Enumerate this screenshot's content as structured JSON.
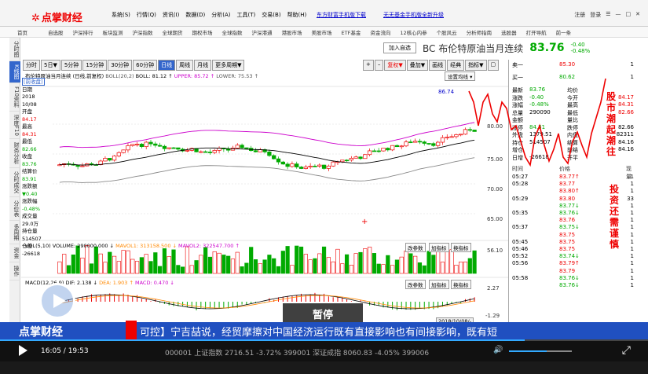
{
  "app": {
    "logo": "点掌财经"
  },
  "menu": [
    "系统(S)",
    "行情(Q)",
    "资讯(I)",
    "数据(D)",
    "分析(A)",
    "工具(T)",
    "交易(B)",
    "帮助(H)"
  ],
  "ads": {
    "ad1": "东方财富手机版下载",
    "ad2": "无无基金手机版全新升级"
  },
  "win_controls": [
    "注册",
    "登录",
    "☰",
    "—",
    "□",
    "✕"
  ],
  "nav": [
    "首页",
    "自选股",
    "沪深排行",
    "板块监测",
    "沪深指数",
    "全球期货",
    "期权市场",
    "全球指数",
    "沪深港通",
    "港股市场",
    "美股市场",
    "ETF基金",
    "资金流向",
    "12核心内参",
    "个股风云",
    "分析师指南",
    "选股器",
    "打开导航",
    "前一条"
  ],
  "sidebar": [
    "分时图",
    "K线图",
    "F10资料",
    "深度F10",
    "财务分析",
    "分时成交",
    "分价表",
    "多周期",
    "资金",
    "操作"
  ],
  "header": {
    "add_label": "加入自选",
    "title": "BC 布伦特原油当月连续",
    "price": "83.76",
    "chg": "-0.40",
    "chg_pct": "-0.48%"
  },
  "period_tabs": [
    "分时",
    "5日▼",
    "5分钟",
    "15分钟",
    "30分钟",
    "60分钟",
    "日线",
    "周线",
    "月线",
    "更多周期▼"
  ],
  "tools": [
    "+",
    "–",
    "复权▼",
    "叠加▼",
    "画线",
    "经典",
    "指标▼",
    "▢"
  ],
  "info_line": {
    "name": "布伦特原油当月连续 (日线,前复权)",
    "boll": "BOLL(20,2)",
    "boll_val": "BOLL: 81.12 ↑",
    "upper": "UPPER: 85.72 ↑",
    "lower": "LOWER: 75.53 ↑"
  },
  "settings_label": "设置均线 ▾",
  "legend": [
    {
      "k": "[前收盘]",
      "cls": "hl"
    },
    {
      "k": "日期",
      "cls": ""
    },
    {
      "k": "2018",
      "cls": ""
    },
    {
      "k": "10/08",
      "cls": ""
    },
    {
      "k": "开盘",
      "cls": ""
    },
    {
      "k": "84.17",
      "cls": "red"
    },
    {
      "k": "最高",
      "cls": ""
    },
    {
      "k": "84.31",
      "cls": "red"
    },
    {
      "k": "最低",
      "cls": ""
    },
    {
      "k": "82.66",
      "cls": "green"
    },
    {
      "k": "收盘",
      "cls": ""
    },
    {
      "k": "83.76",
      "cls": "green"
    },
    {
      "k": "结算价",
      "cls": ""
    },
    {
      "k": "83.91",
      "cls": "green"
    },
    {
      "k": "涨跌额",
      "cls": ""
    },
    {
      "k": "▼0.40",
      "cls": "green"
    },
    {
      "k": "涨跌幅",
      "cls": ""
    },
    {
      "k": "-0.48%",
      "cls": "green"
    },
    {
      "k": "成交量",
      "cls": ""
    },
    {
      "k": "29.0万",
      "cls": ""
    },
    {
      "k": "持仓量",
      "cls": ""
    },
    {
      "k": "514507",
      "cls": ""
    },
    {
      "k": "仓差",
      "cls": ""
    },
    {
      "k": "-26618",
      "cls": ""
    }
  ],
  "axis_labels": {
    "k1": "86.74",
    "k2": "80.00",
    "k3": "75.00",
    "k4": "70.00",
    "k5": "65.00",
    "v1": "56.10",
    "m1": "2.27",
    "m2": "-1.29"
  },
  "vol_line": {
    "name": "VOL(5,10)",
    "vol": "VOLUME: 290000.000 ↓",
    "ma1": "MAVOL1: 313158.500 ↓",
    "ma2": "MAVOL2: 322547.700 ↑"
  },
  "macd_line": {
    "name": "MACD(12,26,9)",
    "dif": "DIF: 2.138 ↓",
    "dea": "DEA: 1.903 ↑",
    "macd": "MACD: 0.470 ↓"
  },
  "mini_buttons": [
    "改参数",
    "加指标",
    "换指标"
  ],
  "date_tag": "2018/10/08/-",
  "quote": {
    "sell1": {
      "label": "卖一",
      "price": "85.30",
      "vol": "1"
    },
    "buy1": {
      "label": "买一",
      "price": "80.62",
      "vol": "1"
    },
    "rows": [
      {
        "l": "最新",
        "v": "83.76",
        "l2": "均价",
        "v2": ""
      },
      {
        "l": "涨跌",
        "v": "-0.40",
        "l2": "今开",
        "v2": "84.17"
      },
      {
        "l": "涨幅",
        "v": "-0.48%",
        "l2": "最高",
        "v2": "84.31"
      },
      {
        "l": "总量",
        "v": "290090",
        "l2": "最低",
        "v2": "82.66"
      },
      {
        "l": "金额",
        "v": "",
        "l2": "量比",
        "v2": ""
      },
      {
        "l": "涨停",
        "v": "84.31",
        "l2": "跌停",
        "v2": "82.66"
      },
      {
        "l": "外盘",
        "v": "1379.51",
        "l2": "内盘",
        "v2": "82311"
      },
      {
        "l": "持仓",
        "v": "514507",
        "l2": "结算",
        "v2": "84.16"
      },
      {
        "l": "增仓",
        "v": "",
        "l2": "前结",
        "v2": "84.16"
      },
      {
        "l": "日增",
        "v": "-26618",
        "l2": "开平",
        "v2": ""
      }
    ],
    "tick_head": {
      "t": "时间",
      "p": "价格",
      "v": "现量"
    },
    "ticks": [
      {
        "t": "05:27",
        "p": "83.77↑",
        "v": "1"
      },
      {
        "t": "05:28",
        "p": "83.77",
        "v": "1"
      },
      {
        "t": "",
        "p": "83.80↑",
        "v": "1"
      },
      {
        "t": "05:29",
        "p": "83.80",
        "v": "33"
      },
      {
        "t": "",
        "p": "83.77↓",
        "v": "1"
      },
      {
        "t": "05:35",
        "p": "83.76↓",
        "v": "1"
      },
      {
        "t": "",
        "p": "83.76",
        "v": "1"
      },
      {
        "t": "05:37",
        "p": "83.75↓",
        "v": "1"
      },
      {
        "t": "",
        "p": "83.75",
        "v": "1"
      },
      {
        "t": "05:45",
        "p": "83.75",
        "v": "1"
      },
      {
        "t": "05:46",
        "p": "83.75",
        "v": "1"
      },
      {
        "t": "05:52",
        "p": "83.74↓",
        "v": "1"
      },
      {
        "t": "05:56",
        "p": "83.79↑",
        "v": "1"
      },
      {
        "t": "",
        "p": "83.79",
        "v": "1"
      },
      {
        "t": "05:58",
        "p": "83.76↓",
        "v": "1"
      },
      {
        "t": "",
        "p": "83.76↓",
        "v": "1"
      }
    ]
  },
  "overlay_text_1": "股市潮起潮往",
  "overlay_text_2": "投资还需谨慎",
  "pause_label": "暂停",
  "ticker": {
    "brand": "点掌财经",
    "news": "可控】宁吉喆说，经贸摩擦对中国经济运行既有直接影响也有间接影响，既有短"
  },
  "player": {
    "time": "16:05 / 19:53",
    "idx": "000001 上证指数  2716.51 -3.72%   399001 深证成指 8060.83 -4.05%   399006",
    "progress": 0.81,
    "volume": 0.6
  }
}
